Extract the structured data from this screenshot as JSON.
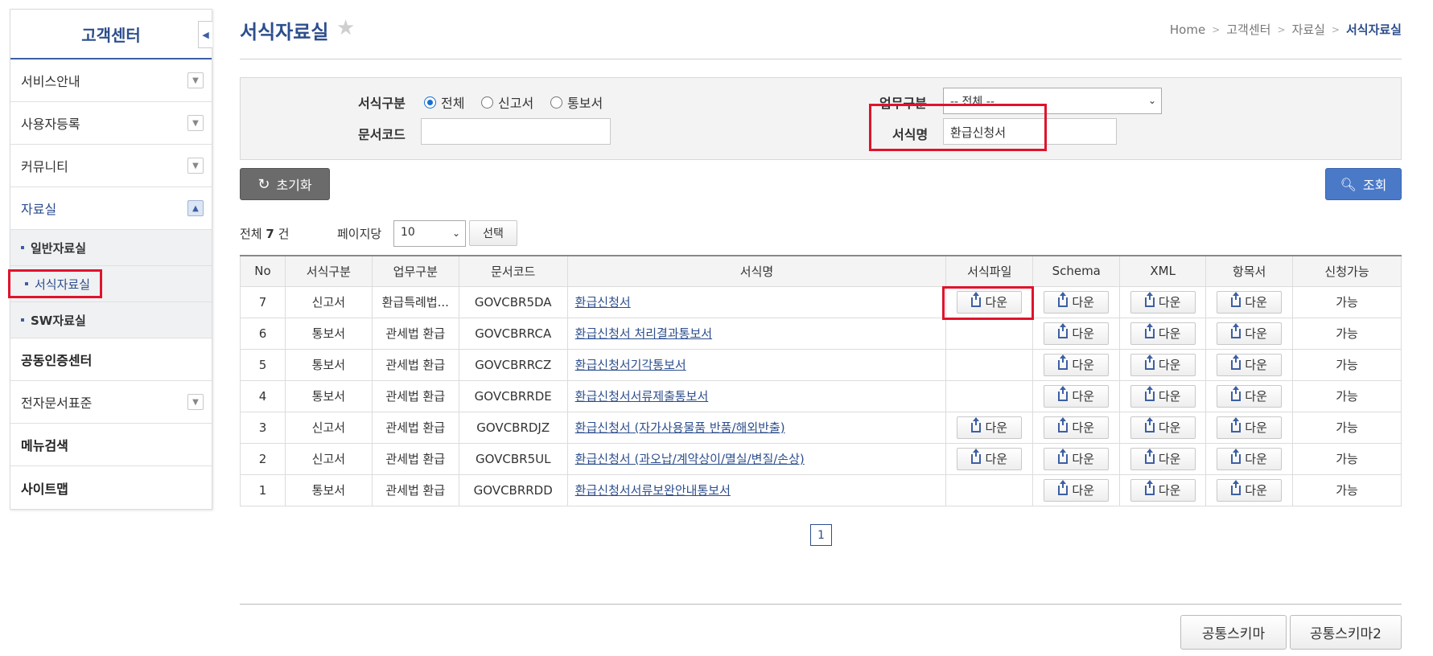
{
  "sidebar": {
    "title": "고객센터",
    "collapse_icon": "caret-left-icon",
    "items": [
      {
        "label": "서비스안내"
      },
      {
        "label": "사용자등록"
      },
      {
        "label": "커뮤니티"
      },
      {
        "label": "자료실"
      }
    ],
    "sub_items": [
      {
        "label": "일반자료실"
      },
      {
        "label": "서식자료실"
      },
      {
        "label": "SW자료실"
      }
    ],
    "bottom_items": [
      {
        "label": "공동인증센터"
      },
      {
        "label": "전자문서표준"
      },
      {
        "label": "메뉴검색"
      },
      {
        "label": "사이트맵"
      }
    ]
  },
  "header": {
    "title": "서식자료실",
    "breadcrumb": [
      "Home",
      "고객센터",
      "자료실",
      "서식자료실"
    ]
  },
  "search": {
    "form_type_label": "서식구분",
    "radio_all": "전체",
    "radio_report": "신고서",
    "radio_notice": "통보서",
    "doc_code_label": "문서코드",
    "doc_code_value": "",
    "task_type_label": "업무구분",
    "task_type_value": "-- 전체 --",
    "form_name_label": "서식명",
    "form_name_value": "환급신청서",
    "reset_label": "초기화",
    "search_label": "조회"
  },
  "list": {
    "total_prefix": "전체",
    "total_count": "7",
    "total_suffix": "건",
    "per_page_label": "페이지당",
    "per_page_value": "10",
    "per_page_button": "선택",
    "columns": [
      "No",
      "서식구분",
      "업무구분",
      "문서코드",
      "서식명",
      "서식파일",
      "Schema",
      "XML",
      "항목서",
      "신청가능"
    ],
    "download_label": "다운",
    "rows": [
      {
        "no": "7",
        "type": "신고서",
        "task": "환급특례법...",
        "code": "GOVCBR5DA",
        "name": "환급신청서",
        "file": true,
        "available": "가능"
      },
      {
        "no": "6",
        "type": "통보서",
        "task": "관세법 환급",
        "code": "GOVCBRRCA",
        "name": "환급신청서 처리결과통보서",
        "file": false,
        "available": "가능"
      },
      {
        "no": "5",
        "type": "통보서",
        "task": "관세법 환급",
        "code": "GOVCBRRCZ",
        "name": "환급신청서기각통보서",
        "file": false,
        "available": "가능"
      },
      {
        "no": "4",
        "type": "통보서",
        "task": "관세법 환급",
        "code": "GOVCBRRDE",
        "name": "환급신청서서류제출통보서",
        "file": false,
        "available": "가능"
      },
      {
        "no": "3",
        "type": "신고서",
        "task": "관세법 환급",
        "code": "GOVCBRDJZ",
        "name": "환급신청서 (자가사용물품 반품/해외반출)",
        "file": true,
        "available": "가능"
      },
      {
        "no": "2",
        "type": "신고서",
        "task": "관세법 환급",
        "code": "GOVCBR5UL",
        "name": "환급신청서 (과오납/계약상이/멸실/변질/손상)",
        "file": true,
        "available": "가능"
      },
      {
        "no": "1",
        "type": "통보서",
        "task": "관세법 환급",
        "code": "GOVCBRRDD",
        "name": "환급신청서서류보완안내통보서",
        "file": false,
        "available": "가능"
      }
    ],
    "current_page": "1"
  },
  "footer": {
    "btn1": "공통스키마",
    "btn2": "공통스키마2"
  },
  "colors": {
    "primary": "#2d4e8c",
    "highlight": "#e0132c",
    "search_button": "#4a79c8"
  }
}
